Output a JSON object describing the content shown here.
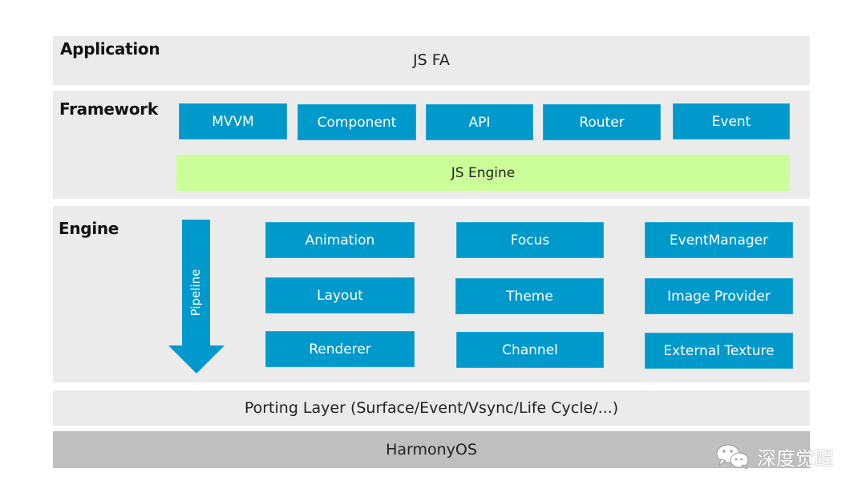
{
  "diagram": {
    "colors": {
      "panel_bg": "#ebebeb",
      "module_blue": "#0099cc",
      "js_engine_green": "#ccff99",
      "os_gray": "#bfbfbf"
    },
    "application": {
      "label": "Application",
      "content": "JS FA"
    },
    "framework": {
      "label": "Framework",
      "modules": [
        "MVVM",
        "Component",
        "API",
        "Router",
        "Event"
      ],
      "js_engine": "JS Engine"
    },
    "engine": {
      "label": "Engine",
      "pipeline_label": "Pipeline",
      "modules": [
        [
          "Animation",
          "Focus",
          "EventManager"
        ],
        [
          "Layout",
          "Theme",
          "Image Provider"
        ],
        [
          "Renderer",
          "Channel",
          "External Texture"
        ]
      ]
    },
    "porting_layer": {
      "label": "Porting Layer (Surface/Event/Vsync/Life Cycle/...)"
    },
    "os": {
      "label": "HarmonyOS"
    },
    "watermark": {
      "icon": "wechat-icon",
      "text": "深度觉醒"
    }
  }
}
